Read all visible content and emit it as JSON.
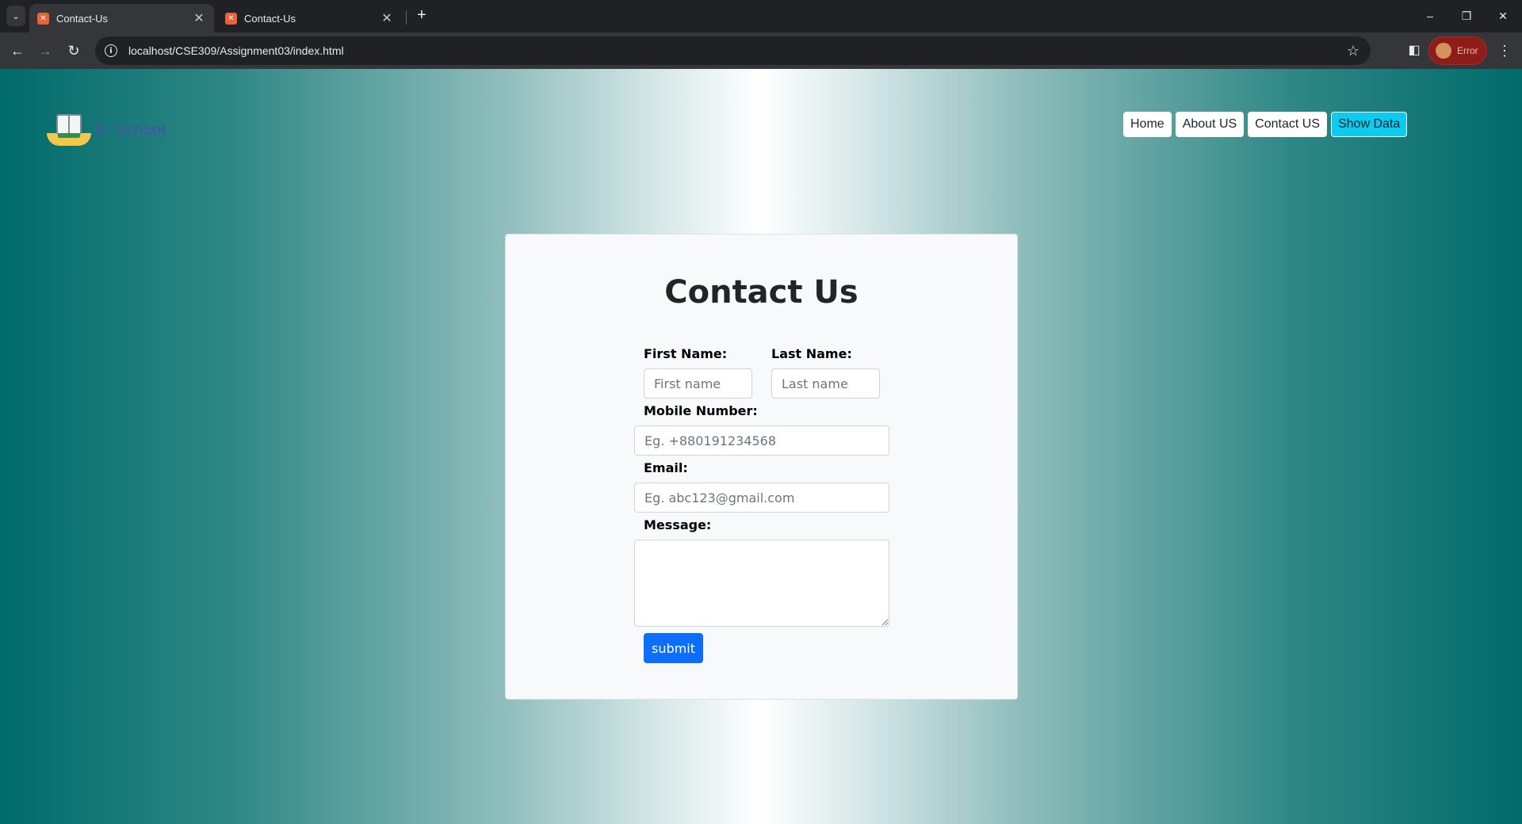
{
  "browser": {
    "tabs": [
      {
        "title": "Contact-Us",
        "active": true
      },
      {
        "title": "Contact-Us",
        "active": false
      }
    ],
    "url": "localhost/CSE309/Assignment03/index.html",
    "profile_label": "Error",
    "icons": {
      "tab_search": "chevron-down-icon",
      "back": "arrow-left-icon",
      "forward": "arrow-right-icon",
      "reload": "reload-icon",
      "site_info": "info-icon",
      "bookmark": "star-icon",
      "side_panel": "side-panel-icon",
      "menu": "kebab-menu-icon",
      "minimize": "minimize-icon",
      "restore": "restore-icon",
      "close": "close-icon",
      "new_tab": "plus-icon"
    }
  },
  "page": {
    "brand": {
      "name": "E- School"
    },
    "nav": [
      {
        "label": "Home"
      },
      {
        "label": "About US"
      },
      {
        "label": "Contact US"
      },
      {
        "label": "Show Data"
      }
    ],
    "form": {
      "title": "Contact Us",
      "first_name": {
        "label": "First Name:",
        "placeholder": "First name",
        "value": ""
      },
      "last_name": {
        "label": "Last Name:",
        "placeholder": "Last name",
        "value": ""
      },
      "mobile": {
        "label": "Mobile Number:",
        "placeholder": "Eg. +880191234568",
        "value": ""
      },
      "email": {
        "label": "Email:",
        "placeholder": "Eg. abc123@gmail.com",
        "value": ""
      },
      "message": {
        "label": "Message:",
        "value": ""
      },
      "submit_label": "submit"
    },
    "colors": {
      "gradient_edge": "#006b6a",
      "gradient_center": "#ffffff",
      "primary_button": "#0d6efd",
      "info_button": "#0dcaf0",
      "brand_text": "#3f5a9f"
    }
  }
}
